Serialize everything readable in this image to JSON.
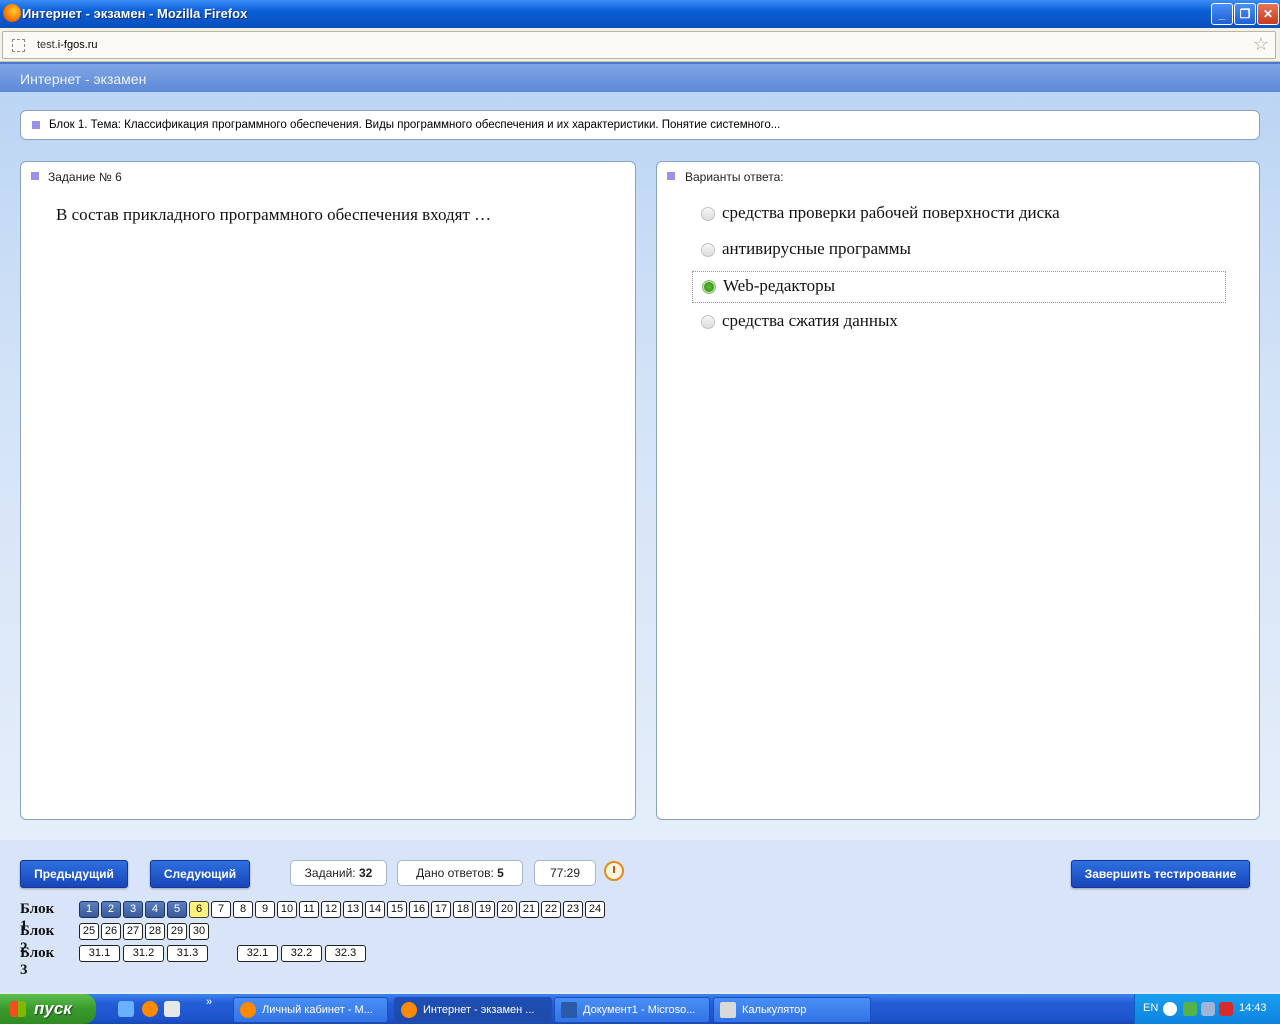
{
  "window": {
    "title": "Интернет - экзамен - Mozilla Firefox"
  },
  "browser": {
    "url_prefix": "test.",
    "url_domain": "i-fgos.ru"
  },
  "page": {
    "header": "Интернет - экзамен"
  },
  "topic": {
    "text": "Блок 1. Тема: Классификация программного обеспечения. Виды программного обеспечения и их характеристики. Понятие системного..."
  },
  "task": {
    "heading": "Задание № 6",
    "question": "В состав прикладного программного обеспечения входят …"
  },
  "answers": {
    "heading": "Варианты ответа:",
    "options": [
      {
        "label": "средства проверки рабочей поверхности диска",
        "selected": false
      },
      {
        "label": "антивирусные программы",
        "selected": false
      },
      {
        "label": "Web-редакторы",
        "selected": true
      },
      {
        "label": "средства сжатия данных",
        "selected": false
      }
    ]
  },
  "controls": {
    "prev_label": "Предыдущий",
    "next_label": "Следующий",
    "tasks_label": "Заданий:",
    "tasks_value": "32",
    "answered_label": "Дано ответов:",
    "answered_value": "5",
    "timer": "77:29",
    "finish_label": "Завершить тестирование"
  },
  "blocks": [
    {
      "label": "Блок 1",
      "cells": [
        "1",
        "2",
        "3",
        "4",
        "5",
        "6",
        "7",
        "8",
        "9",
        "10",
        "11",
        "12",
        "13",
        "14",
        "15",
        "16",
        "17",
        "18",
        "19",
        "20",
        "21",
        "22",
        "23",
        "24"
      ]
    },
    {
      "label": "Блок 2",
      "cells": [
        "25",
        "26",
        "27",
        "28",
        "29",
        "30"
      ]
    },
    {
      "label": "Блок 3",
      "cells": [
        "31.1",
        "31.2",
        "31.3",
        "32.1",
        "32.2",
        "32.3"
      ]
    }
  ],
  "answered_cells": [
    "1",
    "2",
    "3",
    "4",
    "5"
  ],
  "current_cell": "6",
  "taskbar": {
    "start_label": "пуск",
    "tasks": [
      {
        "label": "Личный кабинет - M...",
        "active": false
      },
      {
        "label": "Интернет - экзамен ...",
        "active": true
      },
      {
        "label": "Документ1 - Microso...",
        "active": false
      },
      {
        "label": "Калькулятор",
        "active": false
      }
    ],
    "lang": "EN",
    "clock": "14:43"
  },
  "colors": {
    "accent": "#1846b9",
    "answered": "#3b5a9a",
    "current": "#fff27a",
    "selected_radio": "#3c9a1a"
  }
}
